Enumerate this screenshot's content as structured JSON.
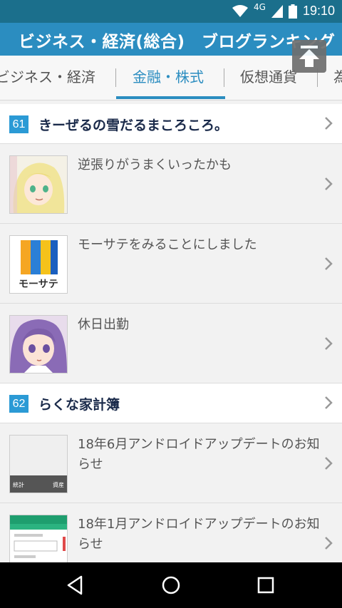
{
  "status": {
    "network": "4G",
    "time": "19:10"
  },
  "header": {
    "title": "ビジネス・経済(総合)　ブログランキング"
  },
  "tabs": [
    {
      "label": "ビジネス・経済"
    },
    {
      "label": "金融・株式"
    },
    {
      "label": "仮想通貨"
    },
    {
      "label": "為"
    }
  ],
  "blogs": [
    {
      "rank": "61",
      "title": "きーぜるの雪だるまころころ。",
      "articles": [
        {
          "title": "逆張りがうまくいったかも"
        },
        {
          "title": "モーサテをみることにしました",
          "thumb_text": "モーサテ"
        },
        {
          "title": "休日出勤"
        }
      ]
    },
    {
      "rank": "62",
      "title": "らくな家計簿",
      "articles": [
        {
          "title": "18年6月アンドロイドアップデートのお知らせ",
          "thumb_left": "統計",
          "thumb_right": "資産"
        },
        {
          "title": "18年1月アンドロイドアップデートのお知らせ"
        }
      ]
    }
  ],
  "colors": {
    "header": "#2b8dc0",
    "status_bar": "#1b6f8c",
    "badge": "#2b9ad5",
    "active_tab": "#2b8dc0"
  }
}
